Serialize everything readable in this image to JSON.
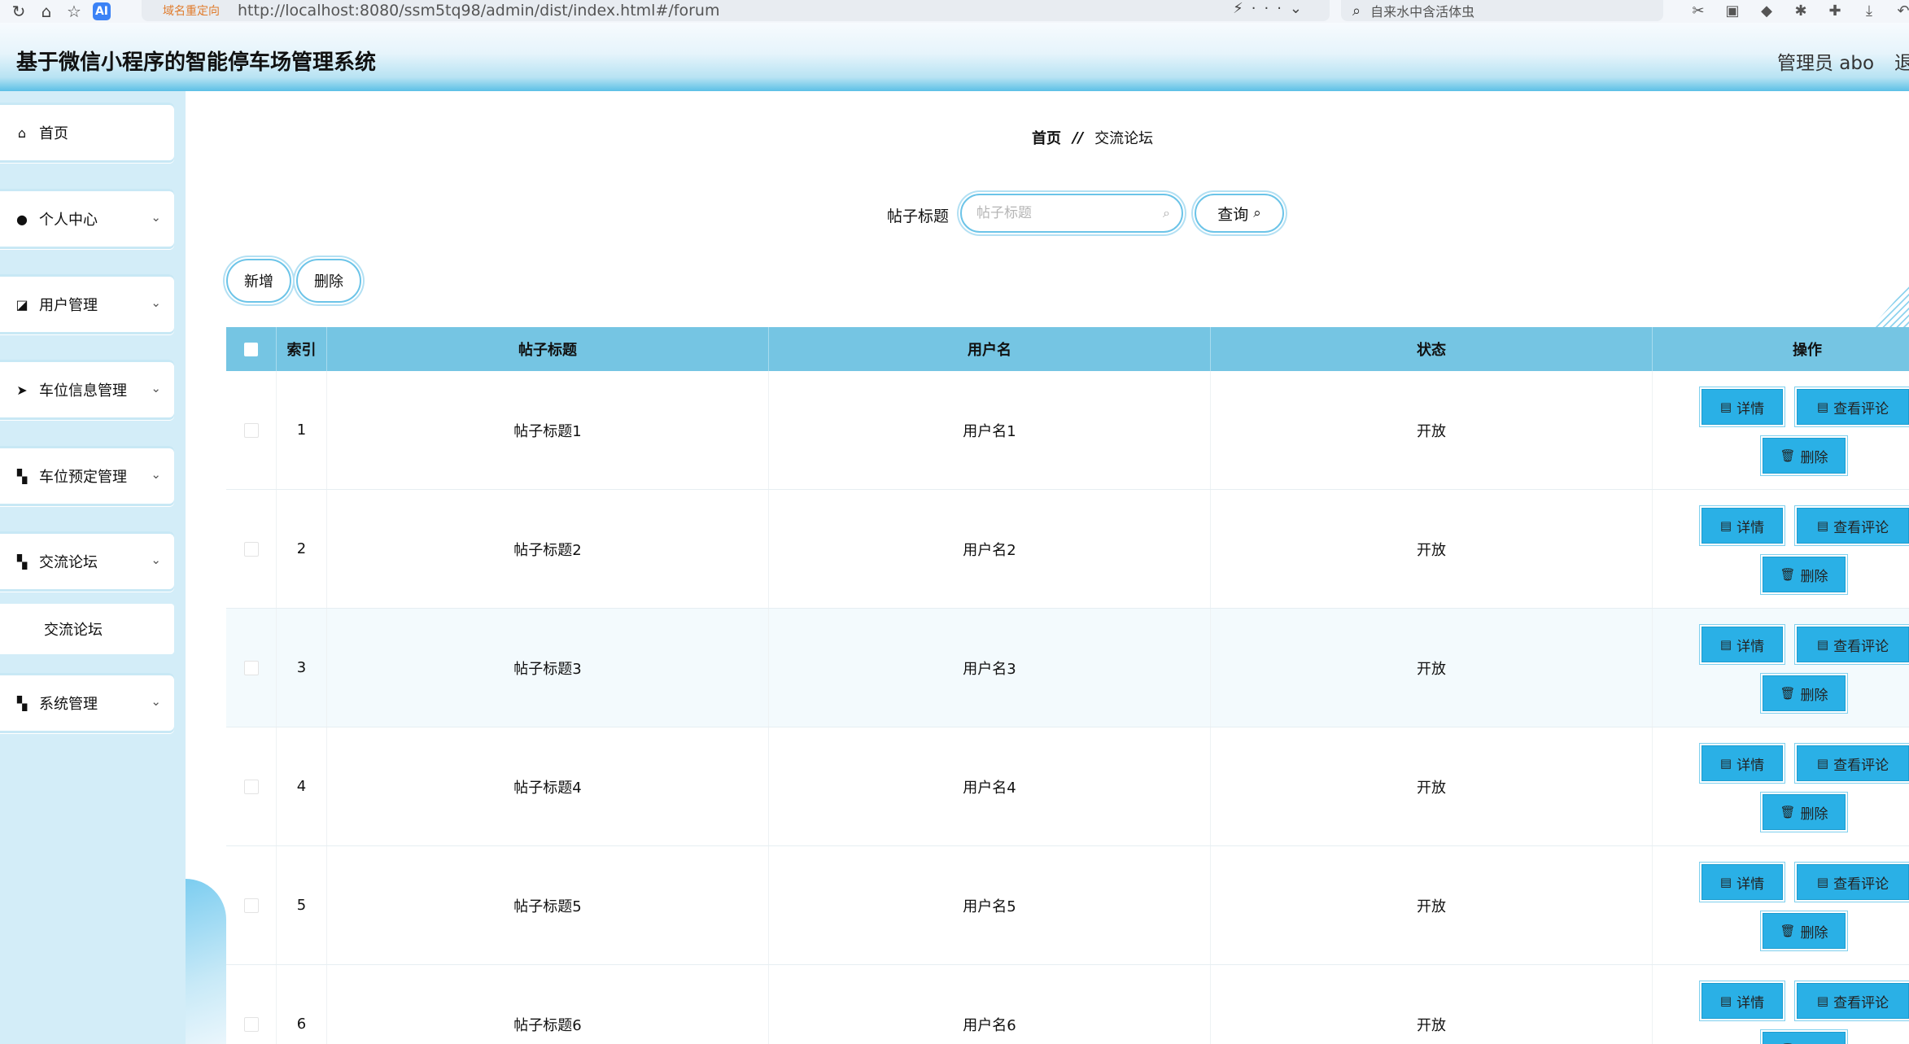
{
  "browser": {
    "ai_badge": "AI",
    "redirect_label": "域名重定向",
    "url": "http://localhost:8080/ssm5tq98/admin/dist/index.html#/forum",
    "search_text": "自来水中含活体虫"
  },
  "header": {
    "title": "基于微信小程序的智能停车场管理系统",
    "user": "管理员 abo",
    "logout": "退"
  },
  "sidebar": {
    "items": [
      {
        "label": "首页",
        "icon": "home-icon",
        "has_children": false
      },
      {
        "label": "个人中心",
        "icon": "user-icon",
        "has_children": true
      },
      {
        "label": "用户管理",
        "icon": "chart-icon",
        "has_children": true
      },
      {
        "label": "车位信息管理",
        "icon": "send-icon",
        "has_children": true
      },
      {
        "label": "车位预定管理",
        "icon": "grid-icon",
        "has_children": true
      },
      {
        "label": "交流论坛",
        "icon": "grid-icon",
        "has_children": true
      },
      {
        "label": "系统管理",
        "icon": "grid-icon",
        "has_children": true
      }
    ],
    "submenu_label": "交流论坛"
  },
  "breadcrumb": {
    "home": "首页",
    "separator": "//",
    "current": "交流论坛"
  },
  "search": {
    "label": "帖子标题",
    "placeholder": "帖子标题",
    "query_button": "查询"
  },
  "toolbar": {
    "add": "新增",
    "delete": "删除"
  },
  "table": {
    "columns": [
      "索引",
      "帖子标题",
      "用户名",
      "状态",
      "操作"
    ],
    "rows": [
      {
        "index": "1",
        "title": "帖子标题1",
        "user": "用户名1",
        "status": "开放"
      },
      {
        "index": "2",
        "title": "帖子标题2",
        "user": "用户名2",
        "status": "开放"
      },
      {
        "index": "3",
        "title": "帖子标题3",
        "user": "用户名3",
        "status": "开放"
      },
      {
        "index": "4",
        "title": "帖子标题4",
        "user": "用户名4",
        "status": "开放"
      },
      {
        "index": "5",
        "title": "帖子标题5",
        "user": "用户名5",
        "status": "开放"
      },
      {
        "index": "6",
        "title": "帖子标题6",
        "user": "用户名6",
        "status": "开放"
      }
    ],
    "actions": {
      "detail": "详情",
      "comments": "查看评论",
      "delete": "删除"
    }
  },
  "colors": {
    "header_gradient_end": "#5cc0e6",
    "sidebar_bg": "#d3edf8",
    "table_header": "#75c5e3",
    "action_button": "#2ab0e6"
  }
}
